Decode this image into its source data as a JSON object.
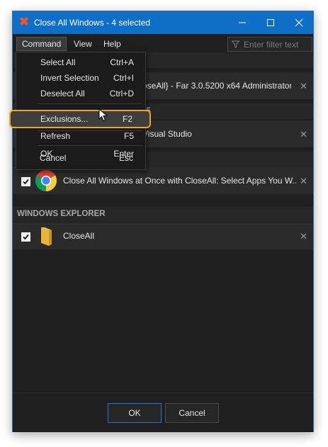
{
  "window": {
    "title": "Close All Windows - 4 selected"
  },
  "menubar": {
    "items": [
      {
        "label": "Command"
      },
      {
        "label": "View"
      },
      {
        "label": "Help"
      }
    ]
  },
  "filter": {
    "placeholder": "Enter filter text"
  },
  "command_menu": {
    "items": [
      {
        "label": "Select All",
        "shortcut": "Ctrl+A"
      },
      {
        "label": "Invert Selection",
        "shortcut": "Ctrl+I"
      },
      {
        "label": "Deselect All",
        "shortcut": "Ctrl+D"
      },
      {
        "label": "Exclusions...",
        "shortcut": "F2"
      },
      {
        "label": "Refresh",
        "shortcut": "F5"
      },
      {
        "label": "OK",
        "shortcut": "Enter"
      },
      {
        "label": "Cancel",
        "shortcut": "Esc"
      }
    ]
  },
  "groups": {
    "far_row": {
      "label": "oseAll} - Far 3.0.5200 x64 Administrator"
    },
    "vs_header_fragment": "15",
    "vs_row": {
      "label": "Visual Studio"
    },
    "chrome_row": {
      "label": "Close All Windows at Once with CloseAll: Select Apps You W..."
    },
    "explorer_header": "WINDOWS EXPLORER",
    "explorer_row": {
      "label": "CloseAll"
    }
  },
  "footer": {
    "ok_label": "OK",
    "cancel_label": "Cancel"
  },
  "colors": {
    "titlebar": "#0f6fc6",
    "background": "#1f1f1f",
    "row": "#2b2b2b",
    "highlight_outline": "#f0a320",
    "primary_border": "#1f78d1"
  }
}
